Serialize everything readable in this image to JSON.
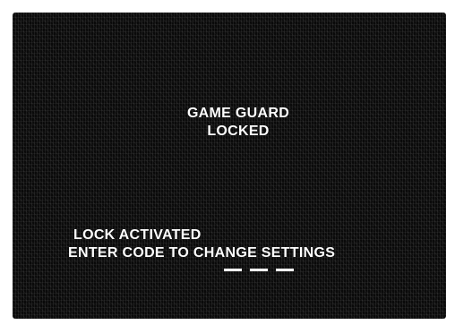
{
  "screen": {
    "title": "GAME GUARD",
    "status": "LOCKED",
    "lock_message": "LOCK ACTIVATED",
    "instruction": "ENTER CODE TO CHANGE SETTINGS",
    "code_slots": 3
  },
  "colors": {
    "background": "#0a0a0a",
    "text": "#ffffff",
    "frame": "#ffffff"
  }
}
